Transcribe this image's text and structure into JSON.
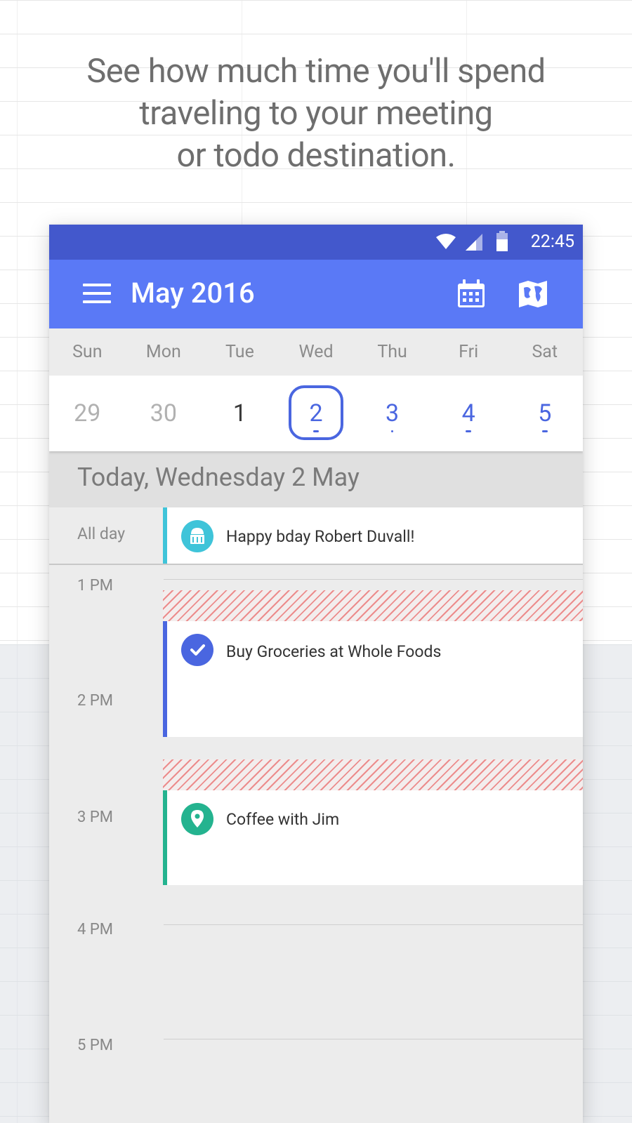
{
  "headline": {
    "lines": [
      "See how much time you'll spend",
      "traveling to your meeting",
      "or todo destination."
    ]
  },
  "statusbar": {
    "time": "22:45"
  },
  "appbar": {
    "title": "May 2016",
    "icons": [
      "menu-icon",
      "calendar-icon",
      "map-icon"
    ]
  },
  "calendar": {
    "weekdays": [
      "Sun",
      "Mon",
      "Tue",
      "Wed",
      "Thu",
      "Fri",
      "Sat"
    ],
    "dates": [
      "29",
      "30",
      "1",
      "2",
      "3",
      "4",
      "5"
    ],
    "selected_date": "2"
  },
  "today_header": "Today, Wednesday 2 May",
  "allday": {
    "label": "All day",
    "event": {
      "title": "Happy bday Robert Duvall!",
      "icon": "cake-icon",
      "color": "#3fc4d9"
    }
  },
  "timeline": {
    "hours": [
      "1 PM",
      "2 PM",
      "3 PM",
      "4 PM",
      "5 PM"
    ],
    "events": [
      {
        "title": "Buy Groceries at Whole Foods",
        "icon": "check-icon",
        "color": "#4a66e0"
      },
      {
        "title": "Coffee with Jim",
        "icon": "location-pin-icon",
        "color": "#24b38f"
      }
    ]
  },
  "colors": {
    "statusbar": "#4358cc",
    "appbar": "#5a79f6",
    "accent": "#4a66e0",
    "travel_stripe": "#ec8c8c"
  }
}
